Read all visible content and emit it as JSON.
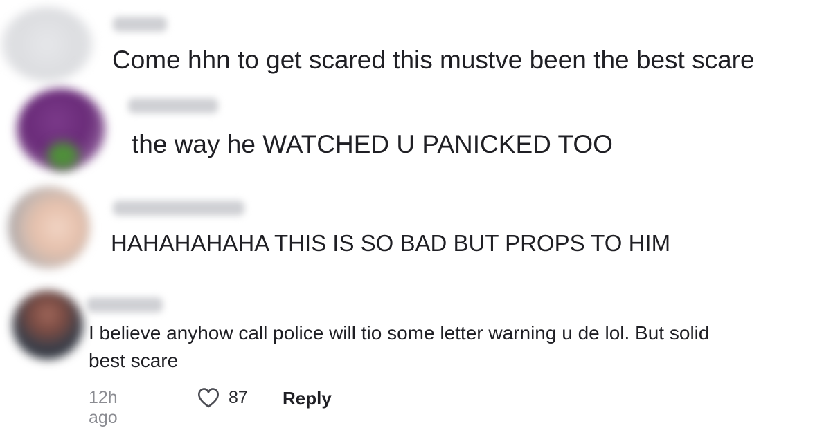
{
  "comments": [
    {
      "text": "Come hhn to get scared this mustve been the best scare"
    },
    {
      "text": "the way he WATCHED U PANICKED TOO"
    },
    {
      "text": "HAHAHAHAHA THIS IS SO BAD BUT PROPS TO HIM"
    },
    {
      "text_line1": "I believe anyhow call police will tio some letter warning u de lol. But solid",
      "text_line2": "best scare",
      "time": "12h ago",
      "likes": "87",
      "reply_label": "Reply"
    }
  ],
  "icons": {
    "like": "heart-outline-icon"
  },
  "colors": {
    "text": "#1f1f24",
    "muted": "#8b8c92"
  }
}
